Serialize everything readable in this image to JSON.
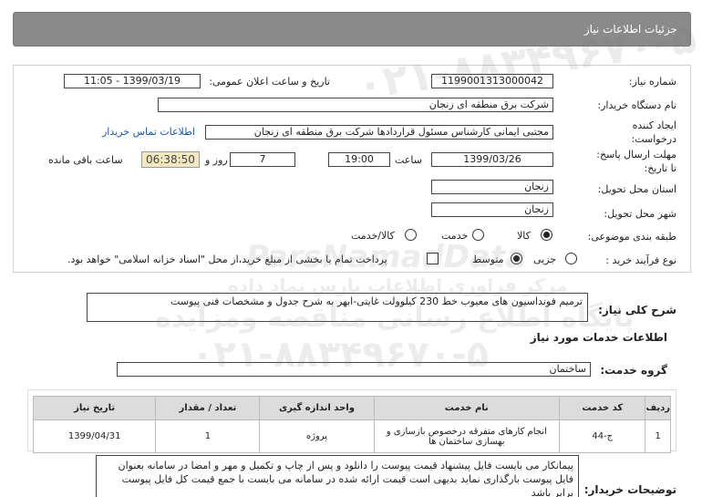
{
  "header": {
    "title": "جزئیات اطلاعات نیاز"
  },
  "form": {
    "need_number_label": "شماره نیاز:",
    "need_number": "1199001313000042",
    "announce_label": "تاریخ و ساعت اعلان عمومی:",
    "announce_value": "1399/03/19 - 11:05",
    "buyer_label": "نام دستگاه خریدار:",
    "buyer_value": "شرکت برق منطقه ای زنجان",
    "creator_label": "ایجاد کننده درخواست:",
    "creator_value": "مجتبی  ایمانی کارشناس مسئول قراردادها شرکت برق منطقه ای زنجان",
    "contact_link": "اطلاعات تماس خریدار",
    "deadline_label": "مهلت ارسال پاسخ: تا تاریخ:",
    "deadline_date": "1399/03/26",
    "time_label": "ساعت",
    "deadline_time": "19:00",
    "days_value": "7",
    "days_label": "روز و",
    "remaining_time": "06:38:50",
    "remaining_label": "ساعت باقی مانده",
    "province_label": "استان محل تحویل:",
    "province_value": "زنجان",
    "city_label": "شهر محل تحویل:",
    "city_value": "زنجان",
    "category_label": "طبقه بندی موضوعی:",
    "category_options": [
      "کالا",
      "خدمت",
      "کالا/خدمت"
    ],
    "process_label": "نوع فرآیند خرید :",
    "process_options": [
      "جزیی",
      "متوسط"
    ],
    "treasury_text": "پرداخت تمام یا بخشی از مبلغ خرید،از محل \"اسناد خزانه اسلامی\" خواهد بود."
  },
  "summary": {
    "label": "شرح کلی نیاز:",
    "value": "ترمیم فونداسیون های معیوب خط 230 کیلوولت غایتی-ابهر به شرح جدول و مشخصات فنی پیوست"
  },
  "services": {
    "section_title": "اطلاعات خدمات مورد نیاز",
    "group_label": "گروه خدمت:",
    "group_value": "ساختمان",
    "columns": [
      "ردیف",
      "کد خدمت",
      "نام خدمت",
      "واحد اندازه گیری",
      "تعداد / مقدار",
      "تاریخ نیاز"
    ],
    "rows": [
      [
        "1",
        "ج-44",
        "انجام کارهای متفرقه درخصوص بازسازی و بهسازی ساختمان ها",
        "پروژه",
        "1",
        "1399/04/31"
      ]
    ]
  },
  "notes": {
    "label": "توضیحات خریدار:",
    "text": "پیمانکار می بایست فایل پیشنهاد قیمت پیوست را دانلود و پس از چاپ و تکمیل و مهر و امضا در سامانه بعنوان فایل پیوست بارگذاری نماید  بدیهی است قیمت ارائه شده در سامانه می بایست با جمع قیمت کل فایل پیوست برابر باشد"
  },
  "watermark": {
    "brand": "ParsNamadData",
    "line1": "مرکز فراوری اطلاعات پارس نماد داده",
    "line2": "پایگاه اطلاع رسانی مناقصه ومزایده",
    "phone": "۰۲۱-۸۸۳۴۹۶۷۰-۵"
  }
}
